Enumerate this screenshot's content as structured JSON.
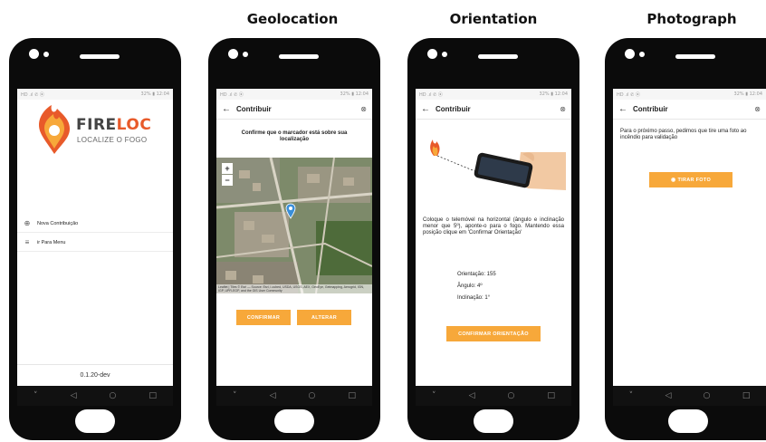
{
  "captions": {
    "geolocation": "Geolocation",
    "orientation": "Orientation",
    "photograph": "Photograph"
  },
  "status": {
    "left": "HD .ıl ✆ ⦿",
    "right": "32% ▮ 12:04"
  },
  "menu": {
    "brand_fire": "FIRE",
    "brand_loc": "LOC",
    "tagline": "LOCALIZE O FOGO",
    "items": [
      {
        "icon": "⊕",
        "label": "Nova Contribuição"
      },
      {
        "icon": "≡",
        "label": "ir Para Menu"
      }
    ],
    "version": "0.1.20-dev"
  },
  "appbar": {
    "back": "←",
    "title": "Contribuir",
    "close": "⊗"
  },
  "geolocation": {
    "prompt": "Confirme que o marcador está sobre sua localização",
    "zoom_in": "+",
    "zoom_out": "−",
    "attribution": "Leaflet | Tiles © Esri — Source: Esri, i-cubed, USDA, USGS, AEX, GeoEye, Getmapping, Aerogrid, IGN, IGP, UPR-EGP, and the GIS User Community",
    "confirm_label": "CONFIRMAR",
    "change_label": "ALTERAR"
  },
  "orientation": {
    "instructions": "Coloque o telemóvel na horizontal (ângulo e inclinação menor que 5º), aponte-o para o fogo. Mantendo essa posição clique em 'Confirmar Orientação'",
    "orientation_line": "Orientação: 155",
    "angle_line": "Ângulo: 4º",
    "inclination_line": "Inclinação: 1°",
    "confirm_label": "CONFIRMAR ORIENTAÇÃO"
  },
  "photograph": {
    "instructions": "Para o próximo passo, pedimos que tire uma foto ao incêndio para validação",
    "button_label": "TIRAR FOTO"
  },
  "nav": {
    "back": "◁",
    "home": "○",
    "recent": "□",
    "down": "˅"
  },
  "colors": {
    "accent": "#f7a83a",
    "fire_orange": "#e85a2a",
    "marker_blue": "#3a8fd9"
  }
}
